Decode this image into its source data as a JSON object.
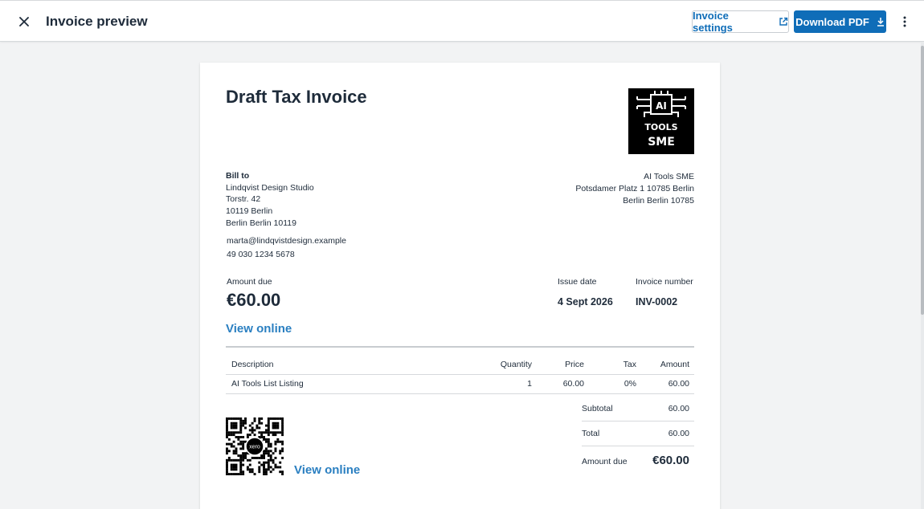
{
  "header": {
    "title": "Invoice preview",
    "settings_label": "Invoice settings",
    "download_label": "Download PDF"
  },
  "invoice": {
    "title": "Draft Tax Invoice",
    "logo_lines": [
      "AI",
      "TOOLS",
      "SME"
    ],
    "bill_to_label": "Bill to",
    "bill_to": [
      "Lindqvist Design Studio",
      "Torstr. 42",
      "10119 Berlin",
      "Berlin Berlin 10119"
    ],
    "contact_email": "marta@lindqvistdesign.example",
    "contact_phone": "49 030 1234 5678",
    "from": [
      "AI Tools SME",
      "Potsdamer Platz 1 10785 Berlin",
      "Berlin Berlin 10785"
    ],
    "amount_due_label": "Amount due",
    "amount_due": "€60.00",
    "issue_date_label": "Issue date",
    "issue_date": "4 Sept 2026",
    "invoice_number_label": "Invoice number",
    "invoice_number": "INV-0002",
    "view_online": "View online",
    "table": {
      "headers": [
        "Description",
        "Quantity",
        "Price",
        "Tax",
        "Amount"
      ],
      "rows": [
        {
          "description": "AI Tools List Listing",
          "quantity": "1",
          "price": "60.00",
          "tax": "0%",
          "amount": "60.00"
        }
      ]
    },
    "totals": {
      "subtotal_label": "Subtotal",
      "subtotal": "60.00",
      "total_label": "Total",
      "total": "60.00",
      "amount_due_label": "Amount due",
      "amount_due": "€60.00"
    },
    "qr_center_text": "xero"
  },
  "colors": {
    "accent": "#0f6db8",
    "link": "#2a7fc1",
    "text": "#1e2b3a"
  }
}
